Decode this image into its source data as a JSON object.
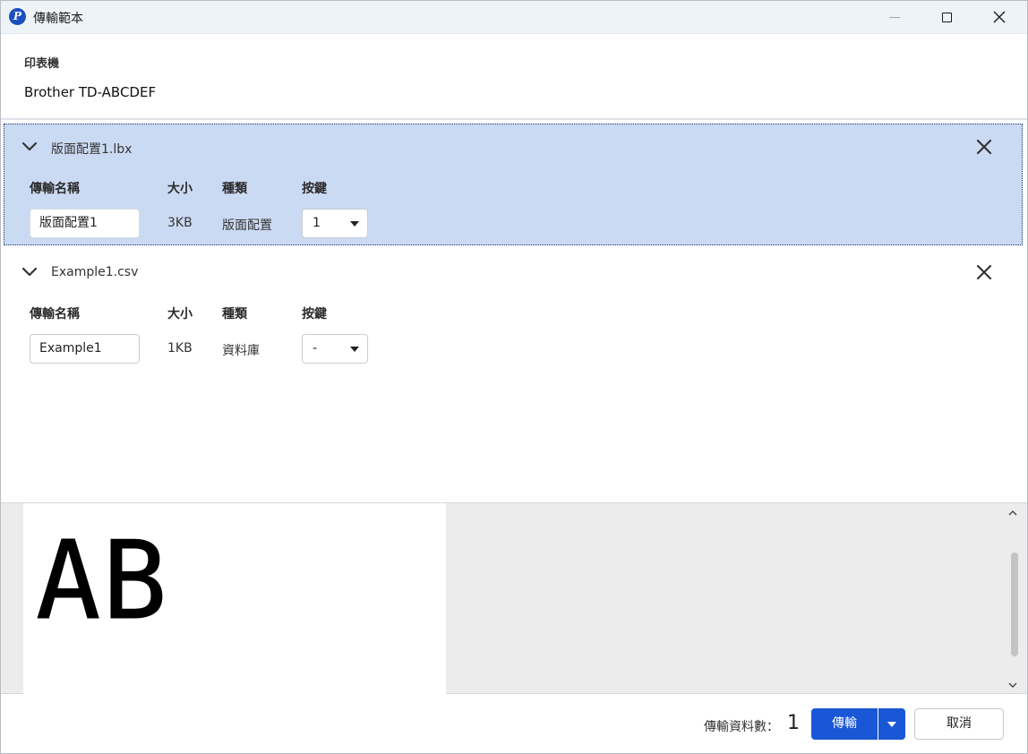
{
  "window": {
    "title": "傳輸範本",
    "app_icon_letter": "P",
    "controls": [
      "minimize-icon",
      "maximize-icon",
      "close-icon"
    ]
  },
  "printer": {
    "label": "印表機",
    "name": "Brother TD-ABCDEF"
  },
  "columns": {
    "name": "傳輸名稱",
    "size": "大小",
    "type": "種類",
    "key": "按鍵"
  },
  "templates": [
    {
      "file": "版面配置1.lbx",
      "transfer_name": "版面配置1",
      "size": "3KB",
      "type": "版面配置",
      "key": "1",
      "selected": true
    },
    {
      "file": "Example1.csv",
      "transfer_name": "Example1",
      "size": "1KB",
      "type": "資料庫",
      "key": "-",
      "selected": false
    }
  ],
  "preview": {
    "label_text": "AB"
  },
  "footer": {
    "count_label": "傳輸資料數：",
    "count_value": "1",
    "transfer_button": "傳輸",
    "cancel_button": "取消"
  },
  "colors": {
    "selected_row": "#cbdaf3",
    "primary": "#1a57d6",
    "titlebar": "#eef3f8"
  }
}
